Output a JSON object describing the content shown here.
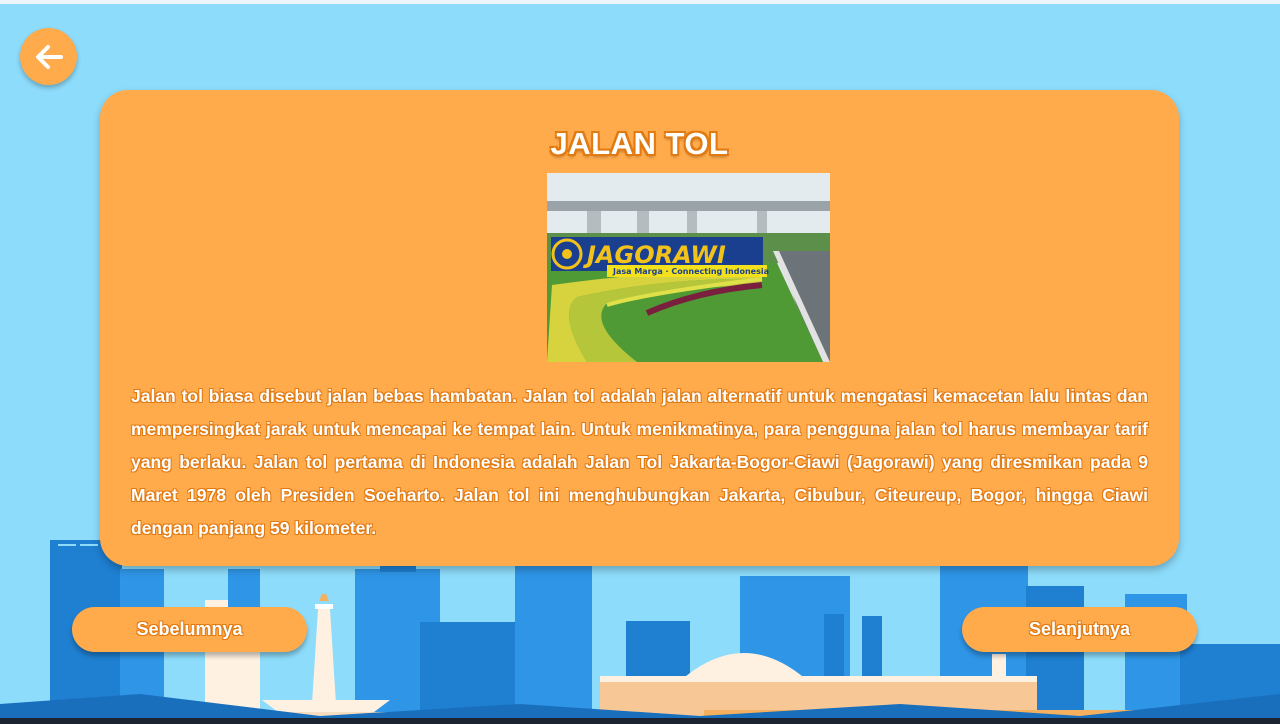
{
  "page": {
    "title": "JALAN TOL",
    "description": "Jalan tol biasa disebut jalan bebas hambatan. Jalan tol adalah jalan alternatif untuk mengatasi kemacetan lalu lintas dan mempersingkat jarak untuk mencapai ke tempat lain. Untuk menikmatinya, para pengguna jalan tol harus membayar tarif yang berlaku. Jalan tol pertama di Indonesia adalah Jalan Tol Jakarta-Bogor-Ciawi (Jagorawi) yang diresmikan pada 9 Maret 1978 oleh Presiden Soeharto. Jalan tol ini menghubungkan Jakarta, Cibubur, Citeureup, Bogor, hingga Ciawi dengan panjang 59 kilometer."
  },
  "photo": {
    "sign_text": "JAGORAWI",
    "sign_subtext": "Jasa Marga · Connecting Indonesia"
  },
  "navigation": {
    "back_icon": "arrow-left-icon",
    "prev_label": "Sebelumnya",
    "next_label": "Selanjutnya"
  },
  "colors": {
    "sky": "#8ddcfb",
    "card": "#ffab4c",
    "text_outline": "#e27a12",
    "building_dark": "#1f7fd1",
    "building_light": "#2f95e6"
  }
}
